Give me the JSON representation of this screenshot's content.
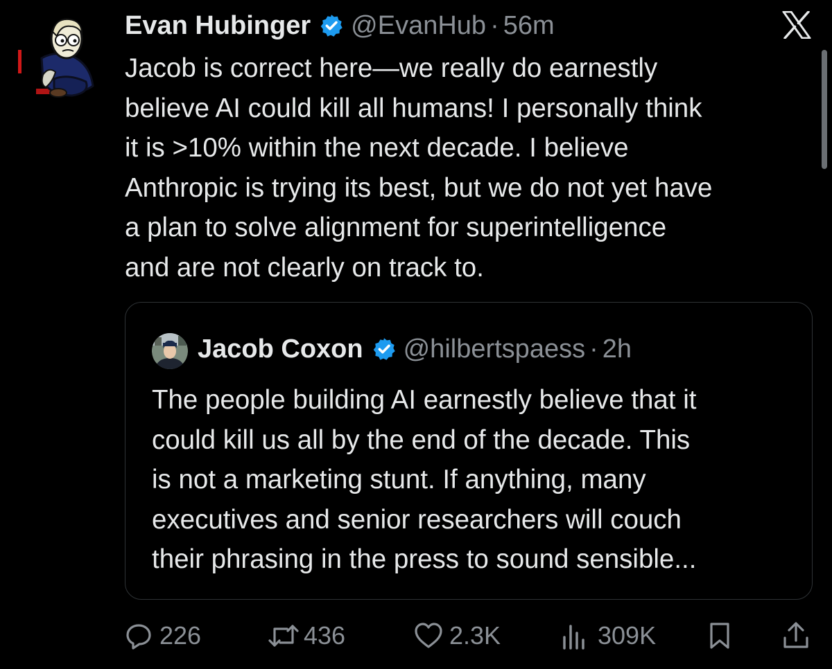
{
  "tweet": {
    "author_name": "Evan Hubinger",
    "handle": "@EvanHub",
    "separator": "·",
    "time": "56m",
    "verified_icon": "verified-badge",
    "body_lines": [
      "Jacob is correct here—we really do earnestly",
      "believe AI could kill all humans! I personally think",
      "it is >10% within the next decade. I believe",
      "Anthropic is trying its best, but we do not yet have",
      "a plan to solve alignment for superintelligence",
      "and are not clearly on track to."
    ]
  },
  "quoted_tweet": {
    "author_name": "Jacob Coxon",
    "handle": "@hilbertspaess",
    "separator": "·",
    "time": "2h",
    "body_lines": [
      "The people building AI earnestly believe that it",
      "could kill us all by the end of the decade. This",
      "is not a marketing stunt. If anything, many",
      "executives and senior researchers will couch",
      "their phrasing in the press to sound sensible..."
    ]
  },
  "actions": {
    "replies": "226",
    "reposts": "436",
    "likes": "2.3K",
    "views": "309K"
  },
  "colors": {
    "background": "#000000",
    "text": "#e7e9ea",
    "secondary_text": "#8b9096",
    "verified_blue": "#1d9bf0",
    "border": "#2f3336"
  }
}
